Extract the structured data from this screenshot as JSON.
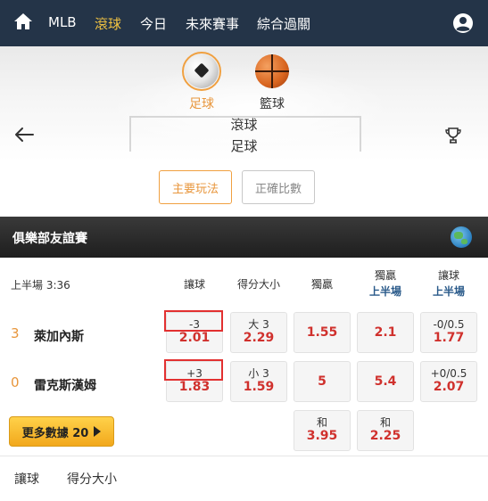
{
  "nav": {
    "items": [
      {
        "label": "MLB",
        "active": false
      },
      {
        "label": "滾球",
        "active": true
      },
      {
        "label": "今日",
        "active": false
      },
      {
        "label": "未來賽事",
        "active": false
      },
      {
        "label": "綜合過關",
        "active": false
      }
    ],
    "home_icon": "home-icon",
    "user_icon": "user-icon"
  },
  "sports": {
    "football": "足球",
    "basketball": "籃球"
  },
  "page": {
    "title": "滾球",
    "subtitle": "足球"
  },
  "modes": {
    "main": "主要玩法",
    "correct_score": "正確比數"
  },
  "league": {
    "name": "俱樂部友誼賽"
  },
  "match": {
    "period_time": "上半場  3:36",
    "columns": {
      "handicap": "讓球",
      "over_under": "得分大小",
      "moneyline": "獨贏",
      "moneyline_1h": "獨贏",
      "moneyline_1h_sub": "上半場",
      "handicap_1h": "讓球",
      "handicap_1h_sub": "上半場"
    },
    "home": {
      "score": "3",
      "name": "萊加內斯",
      "handicap_line": "-3",
      "handicap_odd": "2.01",
      "ou_line": "大 3",
      "ou_odd": "2.29",
      "moneyline": "1.55",
      "moneyline_1h": "2.1",
      "handicap_1h_line": "-0/0.5",
      "handicap_1h_odd": "1.77"
    },
    "away": {
      "score": "0",
      "name": "雷克斯漢姆",
      "handicap_line": "+3",
      "handicap_odd": "1.83",
      "ou_line": "小 3",
      "ou_odd": "1.59",
      "moneyline": "5",
      "moneyline_1h": "5.4",
      "handicap_1h_line": "+0/0.5",
      "handicap_1h_odd": "2.07"
    },
    "draw": {
      "label": "和",
      "moneyline": "3.95",
      "moneyline_1h": "2.25"
    },
    "more_button": "更多數據 20"
  },
  "bottom_tabs": [
    "讓球",
    "得分大小"
  ],
  "colors": {
    "nav_bg": "#243448",
    "active": "#f4c542",
    "accent_orange": "#e8963c",
    "odds_red": "#d0312d",
    "highlight_box": "#e23030"
  }
}
